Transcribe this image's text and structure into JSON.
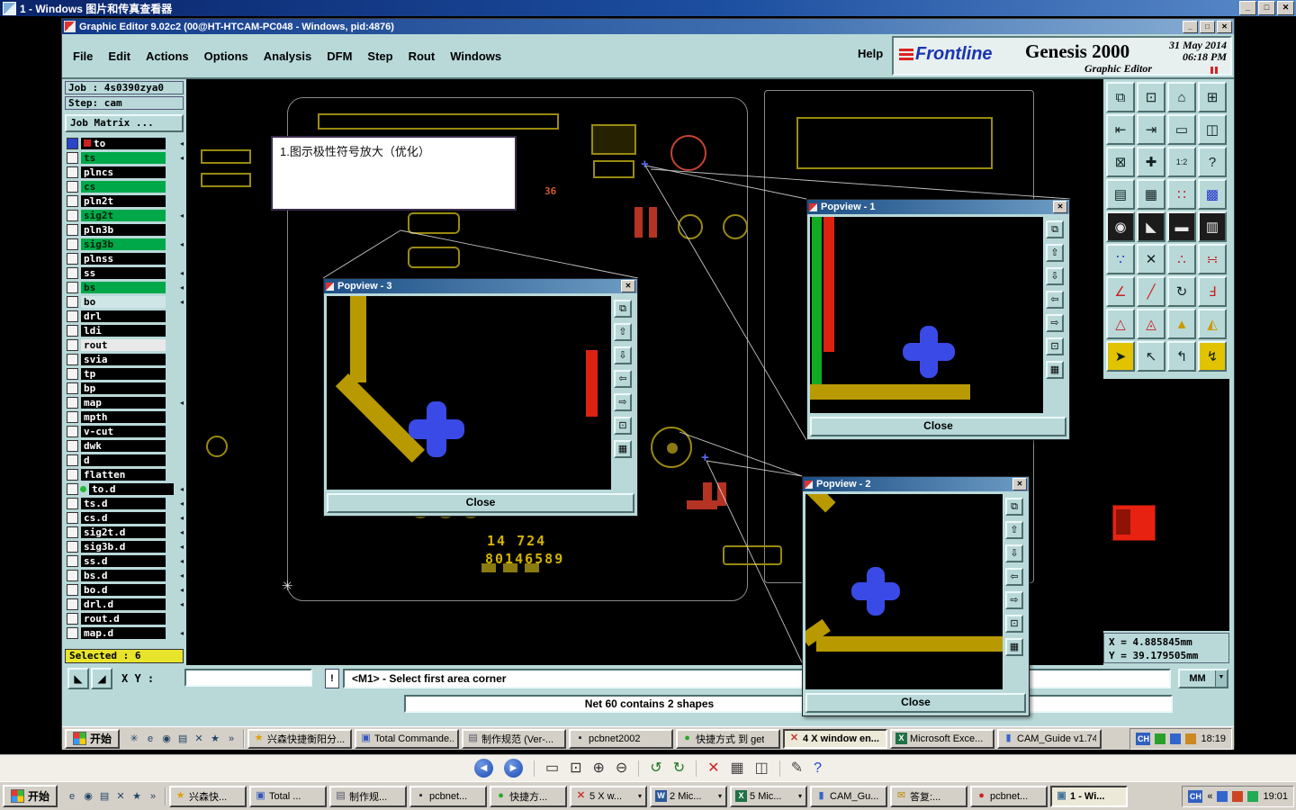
{
  "window": {
    "title": "1 - Windows 图片和传真查看器",
    "min": "_",
    "max": "□",
    "close": "✕"
  },
  "viewer": {
    "toolbar": {
      "icons": [
        {
          "name": "previous-image",
          "glyph": "◀",
          "type": "round"
        },
        {
          "name": "next-image",
          "glyph": "▶",
          "type": "round"
        },
        {
          "type": "sep"
        },
        {
          "name": "actual-size",
          "glyph": "▭"
        },
        {
          "name": "best-fit",
          "glyph": "⊡"
        },
        {
          "name": "zoom-in",
          "glyph": "⊕"
        },
        {
          "name": "zoom-out",
          "glyph": "⊖"
        },
        {
          "type": "sep"
        },
        {
          "name": "rotate-counterclockwise",
          "glyph": "↺",
          "color": "#227722"
        },
        {
          "name": "rotate-clockwise",
          "glyph": "↻",
          "color": "#227722"
        },
        {
          "type": "sep"
        },
        {
          "name": "delete",
          "glyph": "✕",
          "color": "#cc2222"
        },
        {
          "name": "print",
          "glyph": "▦",
          "color": "#444444"
        },
        {
          "name": "save",
          "glyph": "◫",
          "color": "#444444"
        },
        {
          "type": "sep"
        },
        {
          "name": "edit",
          "glyph": "✎",
          "color": "#444444"
        },
        {
          "name": "help",
          "glyph": "?",
          "color": "#2244cc"
        }
      ]
    }
  },
  "editor": {
    "titlebar": {
      "title": "Graphic Editor 9.02c2 (00@HT-HTCAM-PC048 - Windows, pid:4876)",
      "min": "_",
      "max": "□",
      "close": "✕"
    },
    "menu": {
      "items": [
        "File",
        "Edit",
        "Actions",
        "Options",
        "Analysis",
        "DFM",
        "Step",
        "Rout",
        "Windows"
      ],
      "help": "Help"
    },
    "brand": {
      "logo": "Frontline",
      "product": "Genesis 2000",
      "date": "31 May 2014",
      "time": "06:18 PM",
      "subtitle": "Graphic Editor"
    },
    "sidebar": {
      "job": "Job : 4s0390zya0",
      "step": "Step: cam",
      "matrix": "Job Matrix ...",
      "selected": "Selected : 6",
      "layers": [
        {
          "name": "to",
          "style": "dark",
          "arrow": true,
          "cb": "blue",
          "chip": "#cc2222"
        },
        {
          "name": "ts",
          "style": "green",
          "arrow": true
        },
        {
          "name": "plncs",
          "style": "dark"
        },
        {
          "name": "cs",
          "style": "green"
        },
        {
          "name": "pln2t",
          "style": "dark"
        },
        {
          "name": "sig2t",
          "style": "green",
          "arrow": true
        },
        {
          "name": "pln3b",
          "style": "dark"
        },
        {
          "name": "sig3b",
          "style": "green",
          "arrow": true
        },
        {
          "name": "plnss",
          "style": "dark"
        },
        {
          "name": "ss",
          "style": "dark",
          "arrow": true
        },
        {
          "name": "bs",
          "style": "green",
          "arrow": true
        },
        {
          "name": "bo",
          "style": "light",
          "arrow": true
        },
        {
          "name": "drl",
          "style": "dark"
        },
        {
          "name": "ldi",
          "style": "dark"
        },
        {
          "name": "rout",
          "style": "white"
        },
        {
          "name": "svia",
          "style": "dark"
        },
        {
          "name": "tp",
          "style": "dark"
        },
        {
          "name": "bp",
          "style": "dark"
        },
        {
          "name": "map",
          "style": "dark",
          "arrow": true
        },
        {
          "name": "mpth",
          "style": "dark"
        },
        {
          "name": "v-cut",
          "style": "dark"
        },
        {
          "name": "dwk",
          "style": "dark"
        },
        {
          "name": "d",
          "style": "dark"
        },
        {
          "name": "flatten",
          "style": "dark"
        },
        {
          "name": "to.d",
          "style": "dark",
          "arrow": true,
          "dot": "#22bb33"
        },
        {
          "name": "ts.d",
          "style": "dark",
          "arrow": true
        },
        {
          "name": "cs.d",
          "style": "dark",
          "arrow": true
        },
        {
          "name": "sig2t.d",
          "style": "dark",
          "arrow": true
        },
        {
          "name": "sig3b.d",
          "style": "dark",
          "arrow": true
        },
        {
          "name": "ss.d",
          "style": "dark",
          "arrow": true
        },
        {
          "name": "bs.d",
          "style": "dark",
          "arrow": true
        },
        {
          "name": "bo.d",
          "style": "dark",
          "arrow": true
        },
        {
          "name": "drl.d",
          "style": "dark",
          "arrow": true
        },
        {
          "name": "rout.d",
          "style": "dark"
        },
        {
          "name": "map.d",
          "style": "dark",
          "arrow": true
        }
      ]
    },
    "annotation": {
      "text": "1.图示极性符号放大（优化）"
    },
    "canvas": {
      "ref": "36",
      "part_no_1": "14 724",
      "part_no_2": "80146589"
    },
    "popviews": [
      {
        "title": "Popview - 3",
        "close": "Close",
        "close_x": "✕"
      },
      {
        "title": "Popview - 1",
        "close": "Close",
        "close_x": "✕"
      },
      {
        "title": "Popview - 2",
        "close": "Close",
        "close_x": "✕"
      }
    ],
    "tools": {
      "popview_buttons": [
        "⧉",
        "⇧",
        "⇩",
        "⇦",
        "⇨",
        "⊡",
        "▦"
      ],
      "grid": [
        {
          "n": "paste",
          "g": "⧉"
        },
        {
          "n": "screen",
          "g": "⊡"
        },
        {
          "n": "home",
          "g": "⌂"
        },
        {
          "n": "matrix",
          "g": "⊞"
        },
        {
          "n": "pan-left",
          "g": "⇤"
        },
        {
          "n": "pan-right",
          "g": "⇥"
        },
        {
          "n": "window",
          "g": "▭"
        },
        {
          "n": "split-view",
          "g": "◫"
        },
        {
          "n": "zoom-select",
          "g": "⊠"
        },
        {
          "n": "pan-cross",
          "g": "✚"
        },
        {
          "n": "zoom-ratio",
          "g": "1:2",
          "fs": 9
        },
        {
          "n": "help",
          "g": "?"
        },
        {
          "n": "layers",
          "g": "▤"
        },
        {
          "n": "grid-toggle",
          "g": "▦"
        },
        {
          "n": "dots",
          "g": "∷",
          "fg": "#cc2222"
        },
        {
          "n": "fill",
          "g": "▩",
          "fg": "#2233cc"
        },
        {
          "n": "snapshot",
          "g": "◉",
          "bg": "#1c1c1c",
          "fg": "#e8e8e8"
        },
        {
          "n": "shade",
          "g": "◣",
          "bg": "#1c1c1c",
          "fg": "#e8e8e8"
        },
        {
          "n": "ruler",
          "g": "▬",
          "bg": "#1c1c1c",
          "fg": "#e8e8e8"
        },
        {
          "n": "measure",
          "g": "▥",
          "bg": "#1c1c1c",
          "fg": "#e8e8e8"
        },
        {
          "n": "points",
          "g": "∵",
          "fg": "#2233cc"
        },
        {
          "n": "erase",
          "g": "✕"
        },
        {
          "n": "chain",
          "g": "∴",
          "fg": "#cc2222"
        },
        {
          "n": "net-points",
          "g": "∺",
          "fg": "#cc2222"
        },
        {
          "n": "angle",
          "g": "∠",
          "fg": "#cc2222"
        },
        {
          "n": "slope",
          "g": "╱",
          "fg": "#cc2222"
        },
        {
          "n": "arc",
          "g": "↻"
        },
        {
          "n": "transform",
          "g": "Ⅎ",
          "fg": "#cc2222"
        },
        {
          "n": "triangle",
          "g": "△",
          "fg": "#cc2222"
        },
        {
          "n": "triangle-mark",
          "g": "◬",
          "fg": "#cc2222"
        },
        {
          "n": "triangle-fill",
          "g": "▲",
          "fg": "#cc9900"
        },
        {
          "n": "triangle-half",
          "g": "◭",
          "fg": "#cc9900"
        },
        {
          "n": "select-yellow",
          "g": "➤",
          "bg": "#e2c300"
        },
        {
          "n": "select",
          "g": "↖"
        },
        {
          "n": "select-corner",
          "g": "↰"
        },
        {
          "n": "select-flash",
          "g": "↯",
          "bg": "#e2c300"
        }
      ]
    },
    "status": {
      "xy_label": "X Y :",
      "xy_value": "",
      "bang": "!",
      "prompt": "<M1> - Select first area corner",
      "net": "Net 60 contains 2 shapes",
      "units": "MM",
      "coord_x": "X = 4.885845mm",
      "coord_y": "Y = 39.179505mm"
    },
    "taskbar": {
      "start": "开始",
      "quicklaunch": [
        "✳",
        "e",
        "◉",
        "▤",
        "✕",
        "★",
        "»"
      ],
      "items": [
        {
          "icon": "star",
          "label": "兴森快捷衡阳分..."
        },
        {
          "icon": "blue",
          "label": "Total Commande..."
        },
        {
          "icon": "doc",
          "label": "制作规范 (Ver-..."
        },
        {
          "icon": "dark",
          "label": "pcbnet2002"
        },
        {
          "icon": "green",
          "label": "快捷方式 到 get"
        },
        {
          "icon": "x",
          "label": "4 X window en...",
          "active": true
        },
        {
          "icon": "excel",
          "label": "Microsoft Exce..."
        },
        {
          "icon": "book",
          "label": "CAM_Guide v1.74"
        }
      ],
      "tray": {
        "lang": "CH",
        "time": "18:19",
        "icons": [
          "#2aa02a",
          "#3366cc",
          "#cc8822"
        ]
      }
    }
  },
  "taskbar": {
    "start": "开始",
    "quicklaunch": [
      "e",
      "◉",
      "▤",
      "✕",
      "★",
      "»"
    ],
    "items": [
      {
        "icon": "star",
        "label": "兴森快..."
      },
      {
        "icon": "blue",
        "label": "Total ..."
      },
      {
        "icon": "doc",
        "label": "制作规..."
      },
      {
        "icon": "dark",
        "label": "pcbnet..."
      },
      {
        "icon": "green",
        "label": "快捷方..."
      },
      {
        "icon": "x",
        "label": "5 X w...",
        "dropdown": true
      },
      {
        "icon": "word",
        "label": "2 Mic...",
        "dropdown": true
      },
      {
        "icon": "excel",
        "label": "5 Mic...",
        "dropdown": true
      },
      {
        "icon": "book",
        "label": "CAM_Gu..."
      },
      {
        "icon": "mail",
        "label": "答复:..."
      },
      {
        "icon": "red",
        "label": "pcbnet..."
      },
      {
        "icon": "pic",
        "label": "1 - Wi...",
        "active": true
      }
    ],
    "tray": {
      "lang": "CH",
      "chevron": "«",
      "time": "19:01",
      "icons": [
        "#3366cc",
        "#cc4422",
        "#22aa55"
      ]
    }
  }
}
